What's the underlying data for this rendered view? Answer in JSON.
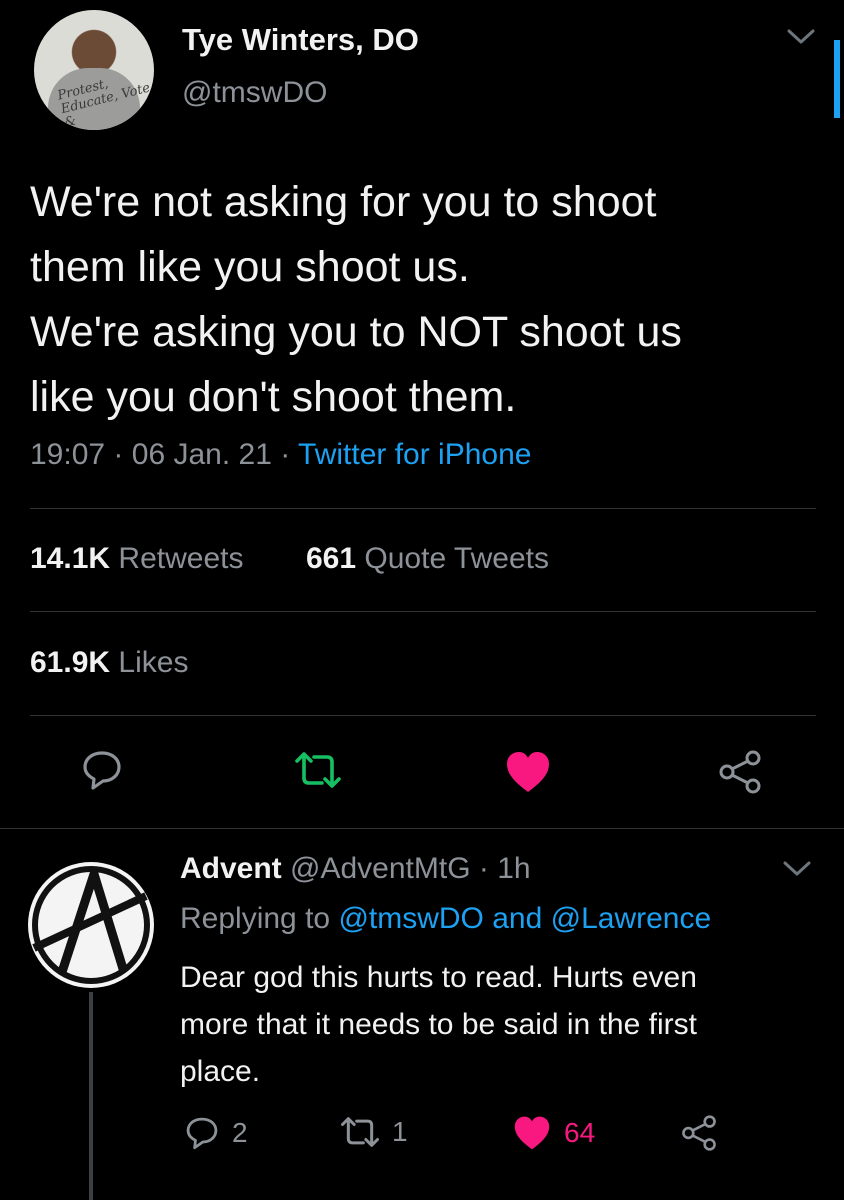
{
  "tweet": {
    "author_name": "Tye Winters, DO",
    "author_handle": "@tmswDO",
    "avatar_shirt_text": "Protest, Educate, Vote &",
    "lines": [
      "We're not asking for you to shoot",
      "them like you shoot us.",
      "We're asking you to NOT shoot us",
      "like you don't shoot them."
    ],
    "time": "19:07",
    "separator": "·",
    "date": "06 Jan. 21",
    "source": "Twitter for iPhone",
    "retweets_count": "14.1K",
    "retweets_label": "Retweets",
    "quotes_count": "661",
    "quotes_label": "Quote Tweets",
    "likes_count": "61.9K",
    "likes_label": "Likes"
  },
  "reply": {
    "author_name": "Advent",
    "author_handle": "@AdventMtG",
    "separator": "·",
    "time": "1h",
    "replying_prefix": "Replying to",
    "replying_user1": "@tmswDO",
    "replying_and": "and",
    "replying_user2": "@Lawrence",
    "lines": [
      "Dear god this hurts to read.  Hurts even",
      "more that it needs to be said in the first",
      "place."
    ],
    "reply_count": "2",
    "retweet_count": "1",
    "like_count": "64"
  },
  "colors": {
    "background": "#000000",
    "text": "#f2f2f2",
    "muted": "#8d9299",
    "link": "#1da1f2",
    "retweet": "#17bf63",
    "like": "#f91880"
  }
}
